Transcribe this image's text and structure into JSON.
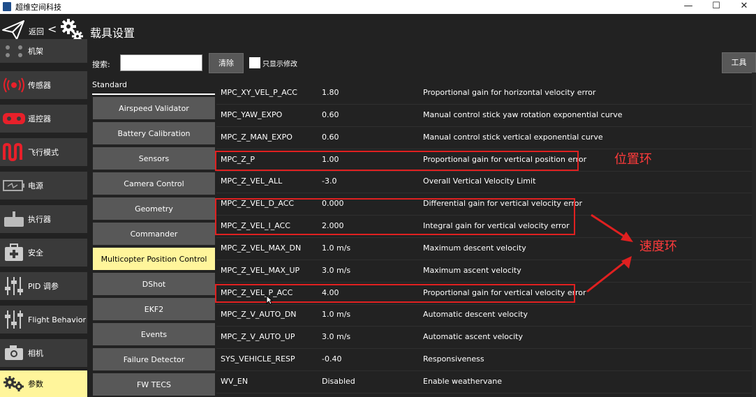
{
  "window": {
    "title": "超维空间科技",
    "controls": [
      "—",
      "☐",
      "✕"
    ]
  },
  "header": {
    "back_label": "返回",
    "back_arrow": "<",
    "page_title": "载具设置"
  },
  "sidebar": {
    "items": [
      {
        "label": "机架",
        "icon": "airframe-icon"
      },
      {
        "label": "传感器",
        "icon": "sensor-icon"
      },
      {
        "label": "遥控器",
        "icon": "radio-icon"
      },
      {
        "label": "飞行模式",
        "icon": "flight-modes-icon"
      },
      {
        "label": "电源",
        "icon": "battery-icon"
      },
      {
        "label": "执行器",
        "icon": "actuator-icon"
      },
      {
        "label": "安全",
        "icon": "safety-icon"
      },
      {
        "label": "PID 调参",
        "icon": "pid-tuning-icon"
      },
      {
        "label": "Flight Behavior",
        "icon": "flight-behavior-icon"
      },
      {
        "label": "相机",
        "icon": "camera-icon"
      },
      {
        "label": "参数",
        "icon": "gears-icon",
        "active": true
      }
    ]
  },
  "toolbar": {
    "search_label": "搜索:",
    "search_value": "",
    "clear_label": "清除",
    "show_modified_label": "只显示修改",
    "tools_label": "工具"
  },
  "groups": {
    "heading": "Standard",
    "items": [
      "Airspeed Validator",
      "Battery Calibration",
      "Sensors",
      "Camera Control",
      "Geometry",
      "Commander",
      "Multicopter Position Control",
      "DShot",
      "EKF2",
      "Events",
      "Failure Detector",
      "FW TECS"
    ],
    "active": "Multicopter Position Control"
  },
  "params": [
    {
      "name": "MPC_XY_VEL_P_ACC",
      "value": "1.80",
      "desc": "Proportional gain for horizontal velocity error"
    },
    {
      "name": "MPC_YAW_EXPO",
      "value": "0.60",
      "desc": "Manual control stick yaw rotation exponential curve"
    },
    {
      "name": "MPC_Z_MAN_EXPO",
      "value": "0.60",
      "desc": "Manual control stick vertical exponential curve"
    },
    {
      "name": "MPC_Z_P",
      "value": "1.00",
      "desc": "Proportional gain for vertical position error"
    },
    {
      "name": "MPC_Z_VEL_ALL",
      "value": "-3.0",
      "desc": "Overall Vertical Velocity Limit"
    },
    {
      "name": "MPC_Z_VEL_D_ACC",
      "value": "0.000",
      "desc": "Differential gain for vertical velocity error"
    },
    {
      "name": "MPC_Z_VEL_I_ACC",
      "value": "2.000",
      "desc": "Integral gain for vertical velocity error"
    },
    {
      "name": "MPC_Z_VEL_MAX_DN",
      "value": "1.0 m/s",
      "desc": "Maximum descent velocity"
    },
    {
      "name": "MPC_Z_VEL_MAX_UP",
      "value": "3.0 m/s",
      "desc": "Maximum ascent velocity"
    },
    {
      "name": "MPC_Z_VEL_P_ACC",
      "value": "4.00",
      "desc": "Proportional gain for vertical velocity error"
    },
    {
      "name": "MPC_Z_V_AUTO_DN",
      "value": "1.0 m/s",
      "desc": "Automatic descent velocity"
    },
    {
      "name": "MPC_Z_V_AUTO_UP",
      "value": "3.0 m/s",
      "desc": "Automatic ascent velocity"
    },
    {
      "name": "SYS_VEHICLE_RESP",
      "value": "-0.40",
      "desc": "Responsiveness"
    },
    {
      "name": "WV_EN",
      "value": "Disabled",
      "desc": "Enable weathervane"
    }
  ],
  "annotations": {
    "position_loop": "位置环",
    "velocity_loop": "速度环",
    "color": "#e02020"
  },
  "colors": {
    "background": "#222222",
    "active_item": "#fff59b",
    "button": "#585858",
    "sidebar_item": "#3a3a3a"
  }
}
